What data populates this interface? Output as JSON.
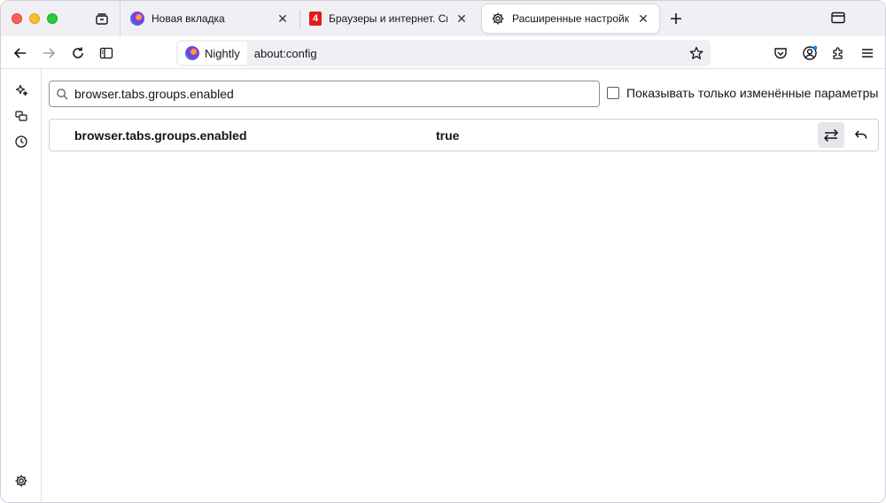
{
  "tabs": [
    {
      "title": "Новая вкладка",
      "icon": "firefox-nightly-icon",
      "active": false
    },
    {
      "title": "Браузеры и интернет. Скачать",
      "icon": "site-red-logo-icon",
      "active": false
    },
    {
      "title": "Расширенные настройки",
      "icon": "gear-icon",
      "active": true
    }
  ],
  "favicon_letter": "4",
  "urlbar": {
    "identity_label": "Nightly",
    "url": "about:config"
  },
  "search": {
    "value": "browser.tabs.groups.enabled"
  },
  "modified_only_label": "Показывать только изменённые параметры",
  "preferences": [
    {
      "name": "browser.tabs.groups.enabled",
      "value": "true"
    }
  ],
  "colors": {
    "tabstrip_bg": "#f0f0f4",
    "accent_badge": "#0a84ff"
  }
}
